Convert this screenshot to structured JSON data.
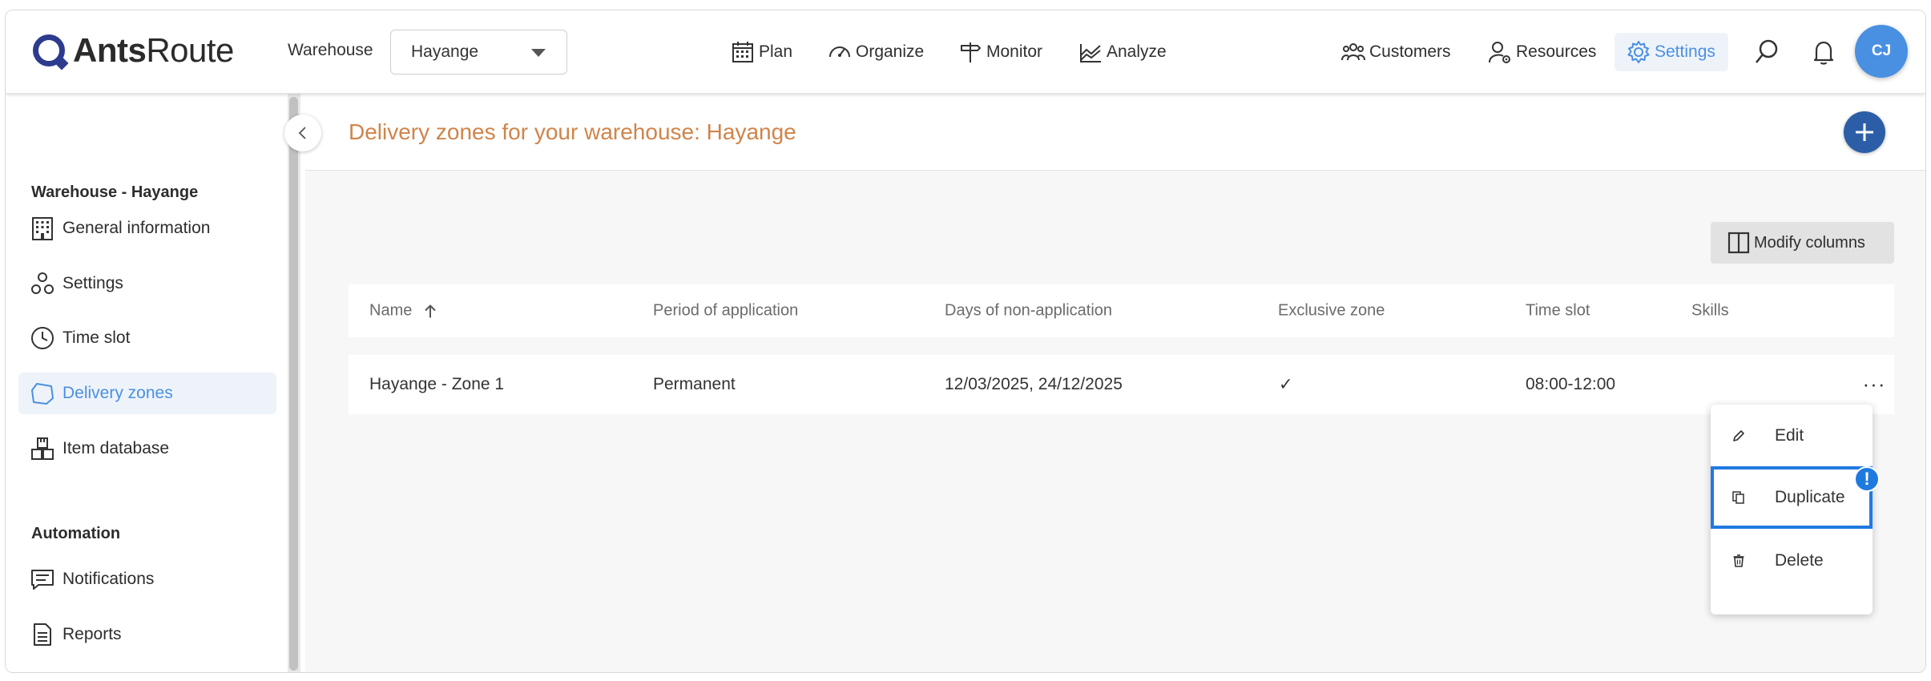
{
  "header": {
    "logo_text_bold": "Ants",
    "logo_text_regular": "Route",
    "warehouse_label": "Warehouse",
    "warehouse_value": "Hayange",
    "nav": [
      {
        "label": "Plan",
        "icon": "calendar-icon"
      },
      {
        "label": "Organize",
        "icon": "speedometer-icon"
      },
      {
        "label": "Monitor",
        "icon": "signpost-icon"
      },
      {
        "label": "Analyze",
        "icon": "chart-icon"
      }
    ],
    "right_nav": [
      {
        "label": "Customers",
        "icon": "users-icon"
      },
      {
        "label": "Resources",
        "icon": "user-gear-icon"
      },
      {
        "label": "Settings",
        "icon": "gear-icon",
        "active": true
      }
    ],
    "avatar_initials": "CJ",
    "accent_color": "#4a90e2"
  },
  "sidebar": {
    "section1_title": "Warehouse - Hayange",
    "items": [
      {
        "label": "General information",
        "icon": "building-icon"
      },
      {
        "label": "Settings",
        "icon": "nodes-icon"
      },
      {
        "label": "Time slot",
        "icon": "clock-icon"
      },
      {
        "label": "Delivery zones",
        "icon": "polygon-icon",
        "active": true
      },
      {
        "label": "Item database",
        "icon": "boxes-icon"
      }
    ],
    "section2_title": "Automation",
    "automation_items": [
      {
        "label": "Notifications",
        "icon": "message-icon"
      },
      {
        "label": "Reports",
        "icon": "document-icon"
      }
    ]
  },
  "main": {
    "title": "Delivery zones for your warehouse: Hayange",
    "title_color": "#d0844a",
    "modify_columns_label": "Modify columns",
    "columns": [
      "Name",
      "Period of application",
      "Days of non-application",
      "Exclusive zone",
      "Time slot",
      "Skills"
    ],
    "sort_column": "Name",
    "rows": [
      {
        "name": "Hayange - Zone 1",
        "period": "Permanent",
        "days_non_application": "12/03/2025, 24/12/2025",
        "exclusive_zone": "✓",
        "time_slot": "08:00-12:00",
        "skills": ""
      }
    ],
    "row_menu_glyph": "···"
  },
  "context_menu": {
    "items": [
      {
        "label": "Edit",
        "icon": "pencil-icon"
      },
      {
        "label": "Duplicate",
        "icon": "copy-icon",
        "highlighted": true
      },
      {
        "label": "Delete",
        "icon": "trash-icon"
      }
    ],
    "badge_text": "!",
    "highlight_color": "#1f7ae0"
  }
}
